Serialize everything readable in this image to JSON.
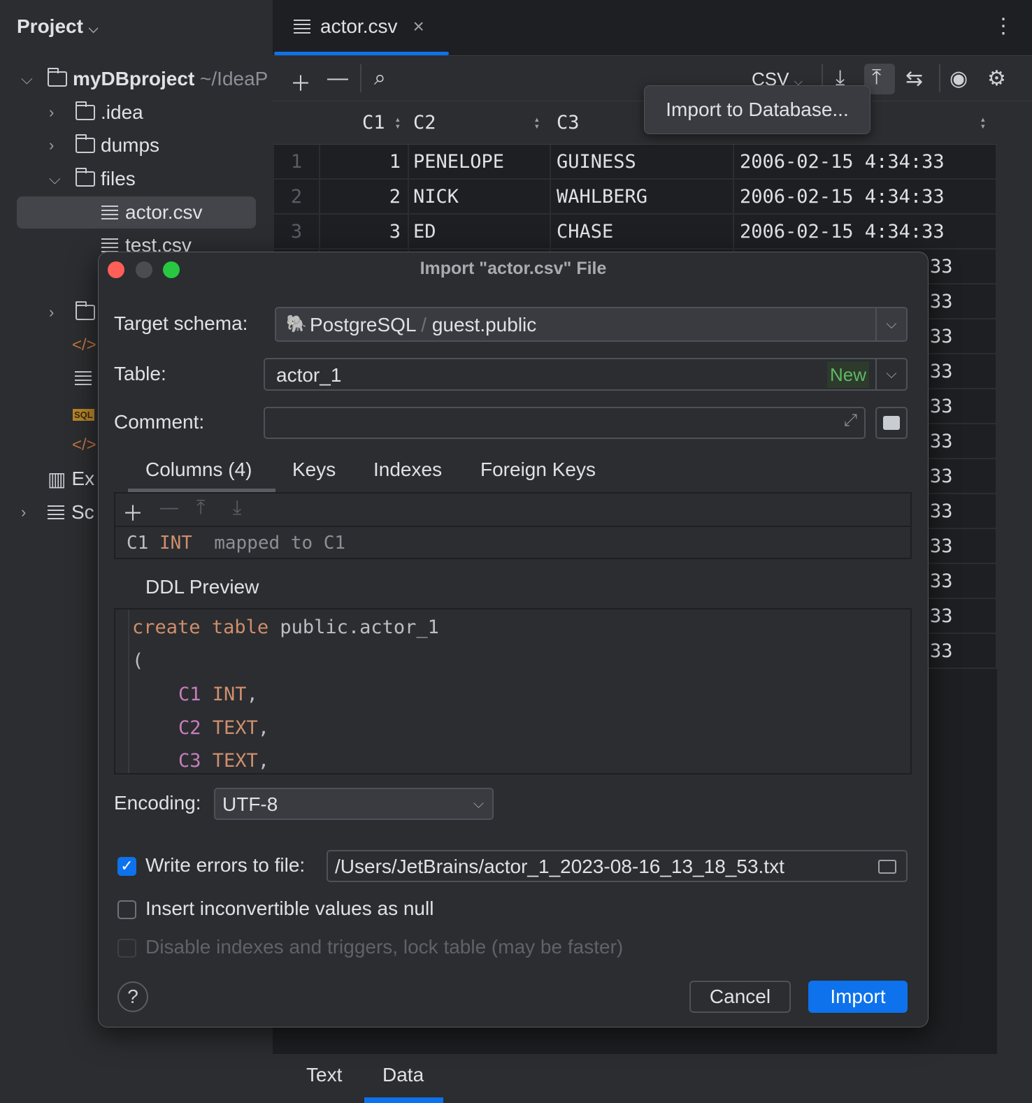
{
  "sidebar": {
    "title": "Project",
    "root": {
      "name": "myDBproject",
      "path": "~/IdeaP"
    },
    "items": [
      ".idea",
      "dumps",
      "files",
      "actor.csv",
      "test.csv"
    ],
    "ext_label": "Ex",
    "scratch_label": "Sc",
    "sql_badge": "SQL"
  },
  "editor": {
    "tab_label": "actor.csv",
    "format": "CSV",
    "tooltip": "Import to Database...",
    "columns": [
      "C1",
      "C2",
      "C3",
      ""
    ],
    "rows": [
      {
        "n": "1",
        "c1": "1",
        "c2": "PENELOPE",
        "c3": "GUINESS",
        "c4": "2006-02-15 4:34:33"
      },
      {
        "n": "2",
        "c1": "2",
        "c2": "NICK",
        "c3": "WAHLBERG",
        "c4": "2006-02-15 4:34:33"
      },
      {
        "n": "3",
        "c1": "3",
        "c2": "ED",
        "c3": "CHASE",
        "c4": "2006-02-15 4:34:33"
      }
    ],
    "partial_rows_tail": [
      "33",
      "33",
      "33",
      "33",
      "33",
      "33",
      "33",
      "33",
      "33",
      "33",
      "33",
      "33"
    ],
    "bottom_tabs": [
      "Text",
      "Data"
    ]
  },
  "dialog": {
    "title": "Import \"actor.csv\" File",
    "target_schema_label": "Target schema:",
    "schema_db": "PostgreSQL",
    "schema_sep": "/",
    "schema_name": "guest.public",
    "table_label": "Table:",
    "table_value": "actor_1",
    "table_badge": "New",
    "comment_label": "Comment:",
    "comment_value": "",
    "tabs": [
      "Columns (4)",
      "Keys",
      "Indexes",
      "Foreign Keys"
    ],
    "column_row": {
      "name": "C1",
      "type": "INT",
      "mapping": "mapped to C1"
    },
    "ddl_label": "DDL Preview",
    "ddl": {
      "l1a": "create",
      "l1b": "table",
      "l1c": "public.actor_1",
      "l2": "(",
      "cols": [
        {
          "n": "C1",
          "t": "INT"
        },
        {
          "n": "C2",
          "t": "TEXT"
        },
        {
          "n": "C3",
          "t": "TEXT"
        }
      ]
    },
    "encoding_label": "Encoding:",
    "encoding_value": "UTF-8",
    "write_errors_label": "Write errors to file:",
    "write_errors_checked": true,
    "errors_path": "/Users/JetBrains/actor_1_2023-08-16_13_18_53.txt",
    "insert_null_label": "Insert inconvertible values as null",
    "insert_null_checked": false,
    "disable_idx_label": "Disable indexes and triggers, lock table (may be faster)",
    "help": "?",
    "cancel": "Cancel",
    "import": "Import"
  },
  "colors": {
    "accent": "#0d72ec",
    "keyword": "#cf8e6d",
    "field": "#c77dbb",
    "new": "#5fb865"
  }
}
